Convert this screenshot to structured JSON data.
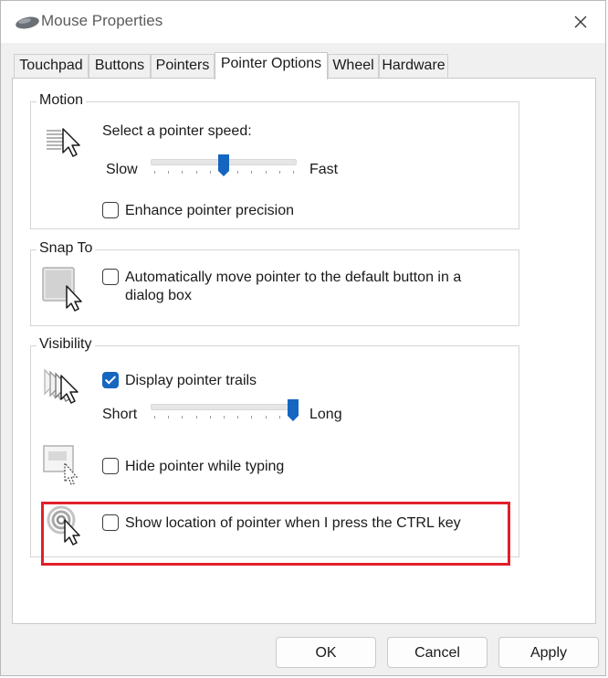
{
  "window": {
    "title": "Mouse Properties",
    "app_icon": "mouse-icon",
    "close_icon": "close-icon"
  },
  "tabs": [
    {
      "label": "Touchpad",
      "active": false
    },
    {
      "label": "Buttons",
      "active": false
    },
    {
      "label": "Pointers",
      "active": false
    },
    {
      "label": "Pointer Options",
      "active": true
    },
    {
      "label": "Wheel",
      "active": false
    },
    {
      "label": "Hardware",
      "active": false
    }
  ],
  "motion": {
    "group_title": "Motion",
    "speed_label": "Select a pointer speed:",
    "slow_label": "Slow",
    "fast_label": "Fast",
    "speed_fraction": 0.5,
    "enhance_label": "Enhance pointer precision",
    "enhance_checked": false
  },
  "snap_to": {
    "group_title": "Snap To",
    "label_line1": "Automatically move pointer to the default button in a",
    "label_line2": "dialog box",
    "checked": false
  },
  "visibility": {
    "group_title": "Visibility",
    "trails_label": "Display pointer trails",
    "trails_checked": true,
    "short_label": "Short",
    "long_label": "Long",
    "trail_fraction": 1.0,
    "hide_label": "Hide pointer while typing",
    "hide_checked": false,
    "show_location_label": "Show location of pointer when I press the CTRL key",
    "show_location_checked": false
  },
  "colors": {
    "accent": "#1566c0",
    "highlight": "#e0202a"
  },
  "buttons": {
    "ok": "OK",
    "cancel": "Cancel",
    "apply": "Apply"
  }
}
